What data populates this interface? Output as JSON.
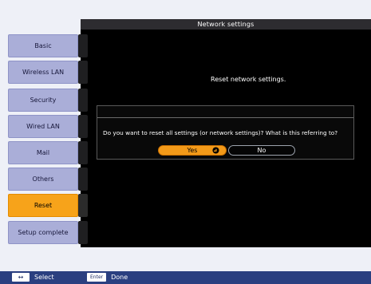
{
  "header": {
    "title": "Network settings"
  },
  "panel": {
    "message": "Reset network settings."
  },
  "sidebar": {
    "items": [
      {
        "label": "Basic",
        "selected": false
      },
      {
        "label": "Wireless LAN",
        "selected": false
      },
      {
        "label": "Security",
        "selected": false
      },
      {
        "label": "Wired LAN",
        "selected": false
      },
      {
        "label": "Mail",
        "selected": false
      },
      {
        "label": "Others",
        "selected": false
      },
      {
        "label": "Reset",
        "selected": true
      },
      {
        "label": "Setup complete",
        "selected": false
      }
    ]
  },
  "dialog": {
    "question": "Do you want to reset all settings (or network settings)? What is this referring to?",
    "yes_label": "Yes",
    "no_label": "No"
  },
  "footer": {
    "select_key": "↔",
    "select_label": "Select",
    "done_key": "Enter",
    "done_label": "Done"
  },
  "colors": {
    "background": "#eef0f7",
    "panel": "#000000",
    "sidebar_item": "#aaaed8",
    "selected": "#f7a31a",
    "footer": "#2a3f80"
  }
}
